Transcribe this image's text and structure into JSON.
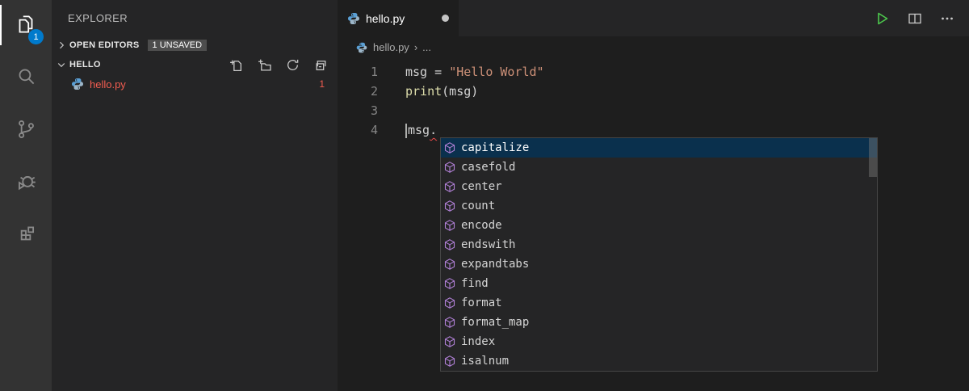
{
  "activity_bar": {
    "items": [
      {
        "id": "explorer",
        "active": true,
        "badge": "1"
      },
      {
        "id": "search",
        "active": false
      },
      {
        "id": "source-control",
        "active": false
      },
      {
        "id": "run-debug",
        "active": false
      },
      {
        "id": "extensions",
        "active": false
      }
    ]
  },
  "sidebar": {
    "title": "EXPLORER",
    "open_editors": {
      "label": "OPEN EDITORS",
      "badge": "1 UNSAVED"
    },
    "folder": {
      "label": "HELLO"
    },
    "toolbar_icons": [
      "new-file",
      "new-folder",
      "refresh",
      "collapse-all"
    ],
    "files": [
      {
        "name": "hello.py",
        "error_count": "1"
      }
    ]
  },
  "editor": {
    "tab": {
      "label": "hello.py",
      "modified": true
    },
    "actions": [
      "run",
      "split-editor",
      "more"
    ],
    "breadcrumbs": {
      "file": "hello.py",
      "separator": "›",
      "more": "..."
    },
    "lines": [
      {
        "num": "1",
        "tokens": [
          {
            "t": "msg = ",
            "c": "fg"
          },
          {
            "t": "\"Hello World\"",
            "c": "string"
          }
        ]
      },
      {
        "num": "2",
        "tokens": [
          {
            "t": "print",
            "c": "func"
          },
          {
            "t": "(msg)",
            "c": "fg"
          }
        ]
      },
      {
        "num": "3",
        "tokens": []
      },
      {
        "num": "4",
        "cursor_before": true,
        "tokens": [
          {
            "t": "msg",
            "c": "fg"
          },
          {
            "t": ".",
            "c": "fg",
            "squiggle": true
          }
        ]
      }
    ],
    "suggest": {
      "selected_index": 0,
      "items": [
        "capitalize",
        "casefold",
        "center",
        "count",
        "encode",
        "endswith",
        "expandtabs",
        "find",
        "format",
        "format_map",
        "index",
        "isalnum"
      ]
    }
  },
  "colors": {
    "activity_badge": "#007acc",
    "error_red": "#f25d50",
    "squiggle_red": "#f14c4c",
    "selection_blue": "#0a304d",
    "method_purple": "#b180d7",
    "run_green": "#4dc94d",
    "string_orange": "#ce9178",
    "function_yellow": "#dcdcaa",
    "python_blue": "#5a9fd4",
    "python_gray": "#9cb6c9"
  }
}
